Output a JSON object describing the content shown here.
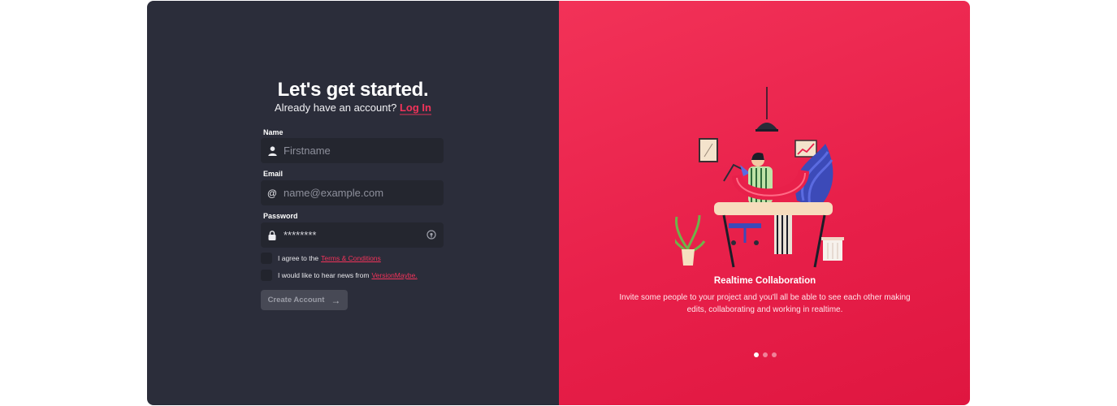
{
  "signup": {
    "title": "Let's get started.",
    "subtitle_text": "Already have an account?",
    "login_link": "Log In",
    "name_label": "Name",
    "name_placeholder": "Firstname",
    "email_label": "Email",
    "email_placeholder": "name@example.com",
    "password_label": "Password",
    "password_value": "********",
    "terms_text": "I agree to the",
    "terms_link": "Terms & Conditions",
    "news_text": "I would like to hear news from",
    "news_link": "VersionMaybe.",
    "create_button": "Create Account",
    "icons": {
      "name": "user-icon",
      "email": "at-icon",
      "password": "lock-icon",
      "reveal": "eye-icon",
      "button": "arrow-right-icon"
    }
  },
  "showcase": {
    "title": "Realtime Collaboration",
    "description": "Invite some people to your project and you'll all be able to see each other making edits, collaborating and working in realtime.",
    "dots_total": 3,
    "active_dot": 1
  },
  "colors": {
    "left_bg": "#2b2d3a",
    "accent": "#f2335a",
    "right_bg": "#e8204a"
  }
}
